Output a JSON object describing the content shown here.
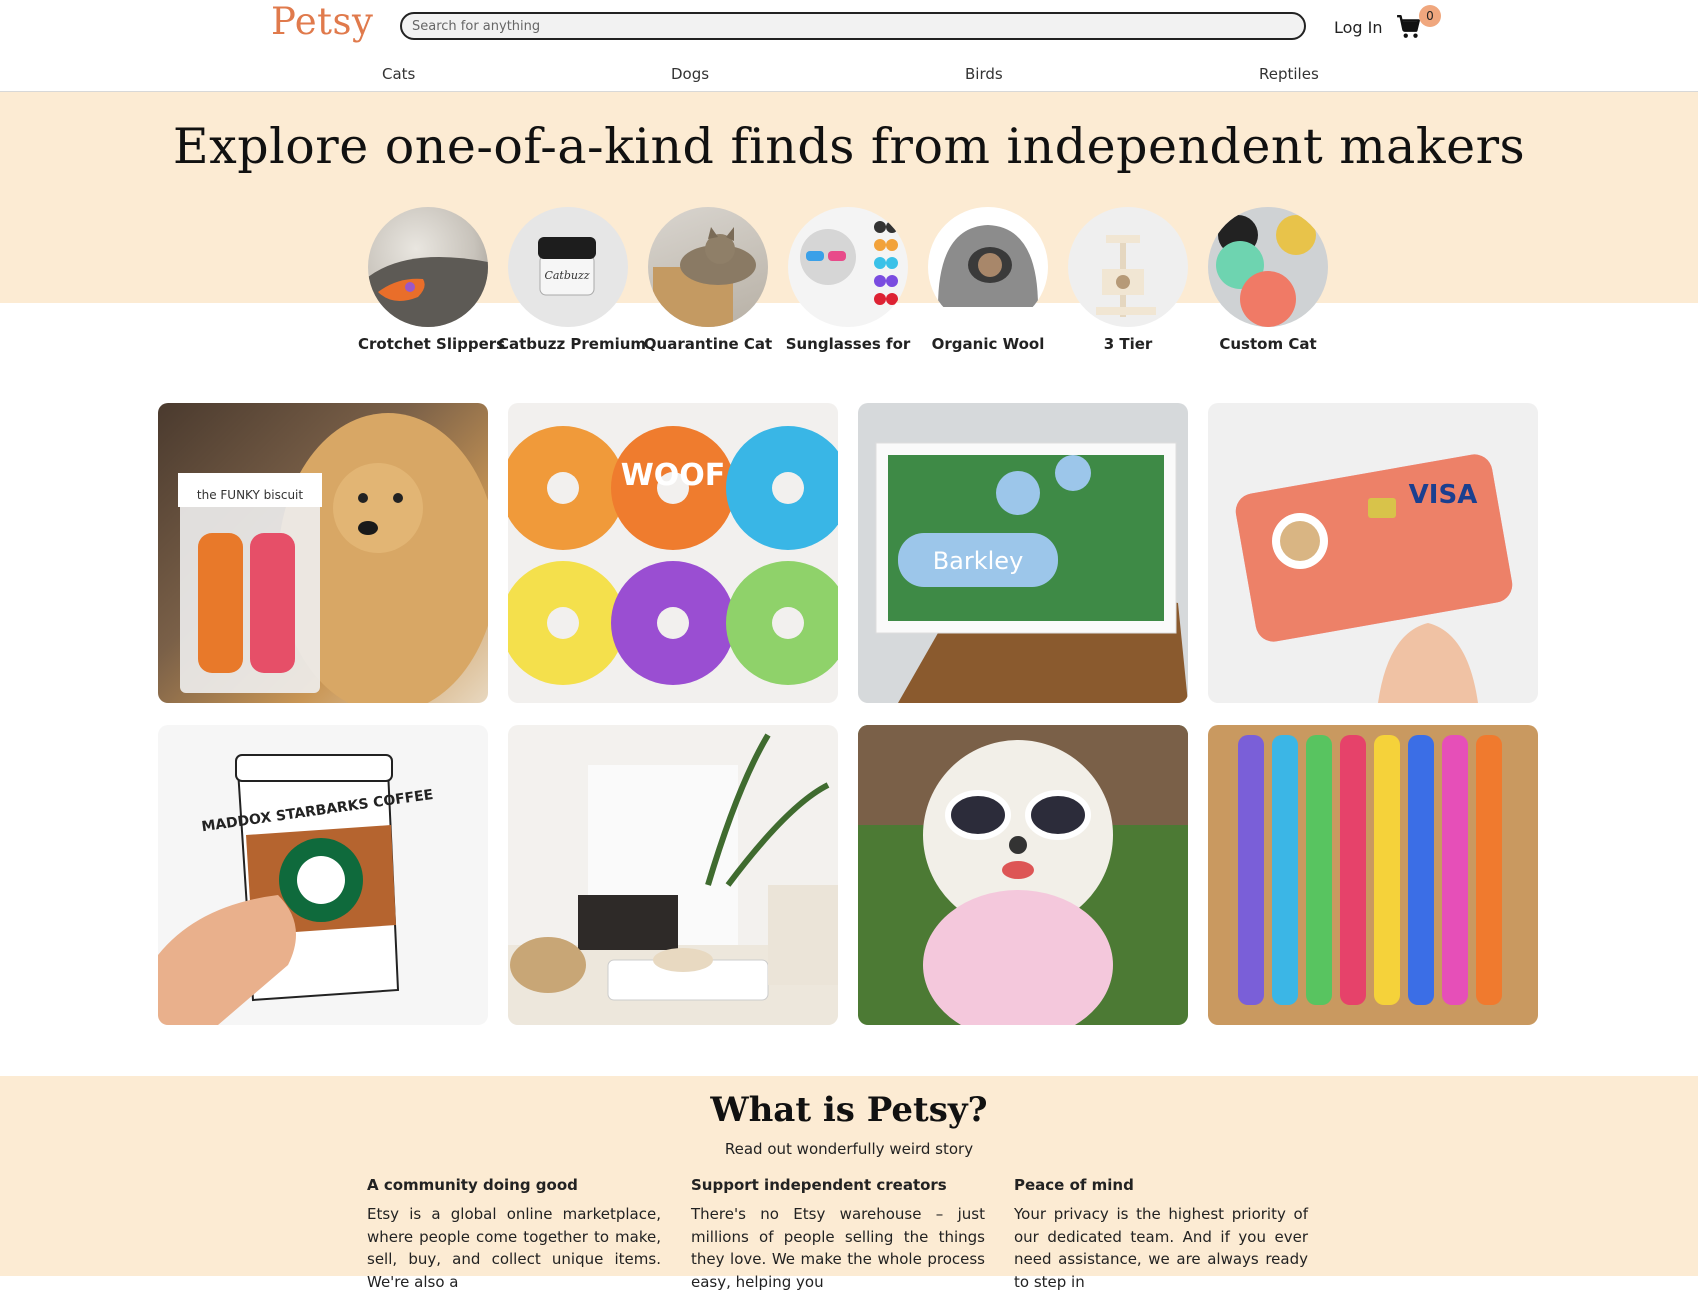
{
  "header": {
    "logo": "Petsy",
    "search_placeholder": "Search for anything",
    "login_label": "Log In",
    "cart_count": "0"
  },
  "nav": [
    "Cats",
    "Dogs",
    "Birds",
    "Reptiles"
  ],
  "hero": {
    "title": "Explore one-of-a-kind finds from independent makers",
    "categories": [
      {
        "label": "Crotchet Slippers"
      },
      {
        "label": "Catbuzz Premium"
      },
      {
        "label": "Quarantine Cat"
      },
      {
        "label": "Sunglasses for"
      },
      {
        "label": "Organic Wool"
      },
      {
        "label": "3 Tier"
      },
      {
        "label": "Custom Cat"
      }
    ]
  },
  "products": [
    {
      "text": "the FUNKY biscuit"
    },
    {
      "text": "WOOF"
    },
    {
      "text": "Barkley"
    },
    {
      "text": "VISA"
    },
    {
      "text": "MADDOX STARBARKS COFFEE"
    },
    {
      "text": ""
    },
    {
      "text": ""
    },
    {
      "text": ""
    }
  ],
  "about": {
    "title": "What is Petsy?",
    "subtitle": "Read out wonderfully weird story",
    "columns": [
      {
        "heading": "A community doing good",
        "body": "Etsy is a global online marketplace, where people come together to make, sell, buy, and collect unique items. We're also a"
      },
      {
        "heading": "Support independent creators",
        "body": "There's no Etsy warehouse – just millions of people selling the things they love. We make the whole process easy, helping you"
      },
      {
        "heading": "Peace of mind",
        "body": "Your privacy is the highest priority of our dedicated team. And if you ever need assistance, we are always ready to step in"
      }
    ]
  },
  "colors": {
    "accent": "#e07a4c",
    "cream": "#fcebd3",
    "badge": "#f0a77e"
  }
}
